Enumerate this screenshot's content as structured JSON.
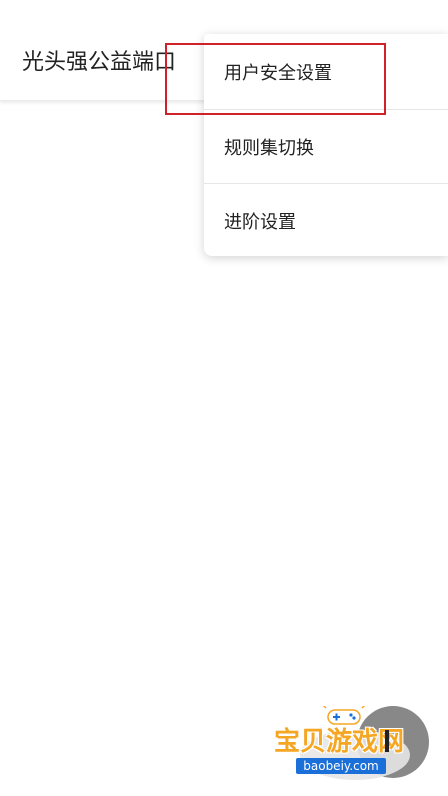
{
  "app_bar": {
    "title": "光头强公益端口"
  },
  "overflow_menu": {
    "items": [
      {
        "label": "用户安全设置"
      },
      {
        "label": "规则集切换"
      },
      {
        "label": "进阶设置"
      }
    ]
  },
  "watermark": {
    "brand": "宝贝游戏网",
    "url": "baobeiy.com"
  },
  "colors": {
    "highlight": "#d0202a",
    "watermark_text": "#f5a623",
    "watermark_url_bg": "#1a6fd8"
  },
  "icons": {
    "watermark_logo": "gamepad-icon"
  }
}
